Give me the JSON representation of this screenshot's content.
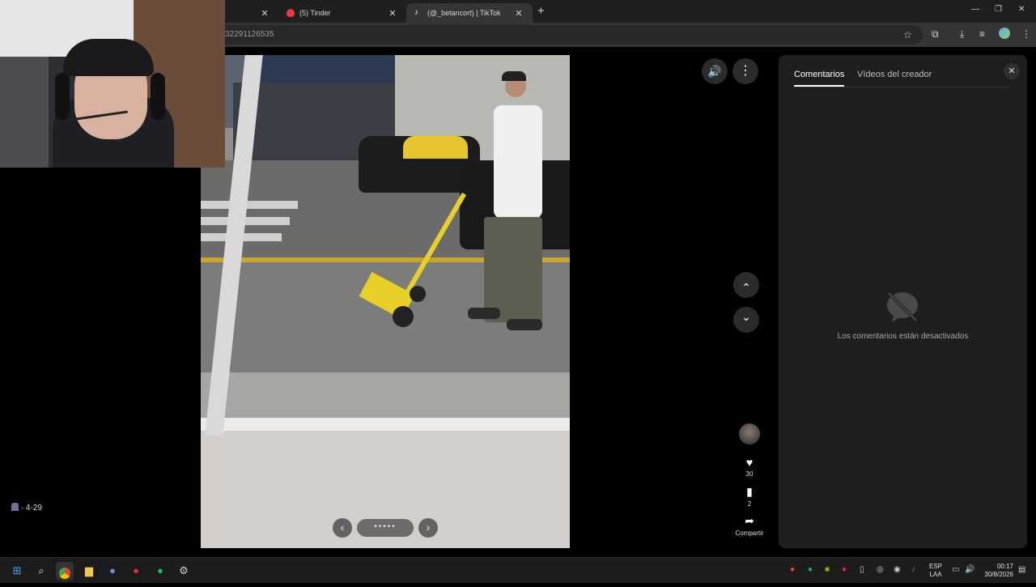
{
  "browser": {
    "tabs": [
      {
        "label": "",
        "active": false
      },
      {
        "label": "(5) Tinder",
        "active": false
      },
      {
        "label": "(@_betancort) | TikTok",
        "active": true
      }
    ],
    "url": "32291126535",
    "new_tab": "+",
    "window_controls": {
      "minimize": "—",
      "restore": "❐",
      "close": "✕"
    }
  },
  "video": {
    "carousel": {
      "prev": "‹",
      "next": "›",
      "dots": "•••••"
    },
    "volume_icon": "🔊",
    "more_icon": "⋮",
    "nav_up": "⌃",
    "nav_down": "⌄"
  },
  "actions": {
    "likes": "30",
    "saves": "2",
    "share_label": "Compartir"
  },
  "comments_panel": {
    "tabs": [
      "Comentarios",
      "Vídeos del creador"
    ],
    "close": "✕",
    "empty_message": "Los comentarios están desactivados"
  },
  "bottom_left": {
    "text": "· 4-29"
  },
  "taskbar": {
    "language": [
      "ESP",
      "LAA"
    ],
    "time": "00:17",
    "date": "30/8/2026"
  },
  "colors": {
    "accent_brand": "#fe2c55",
    "panel_bg": "#1e1e1e"
  }
}
